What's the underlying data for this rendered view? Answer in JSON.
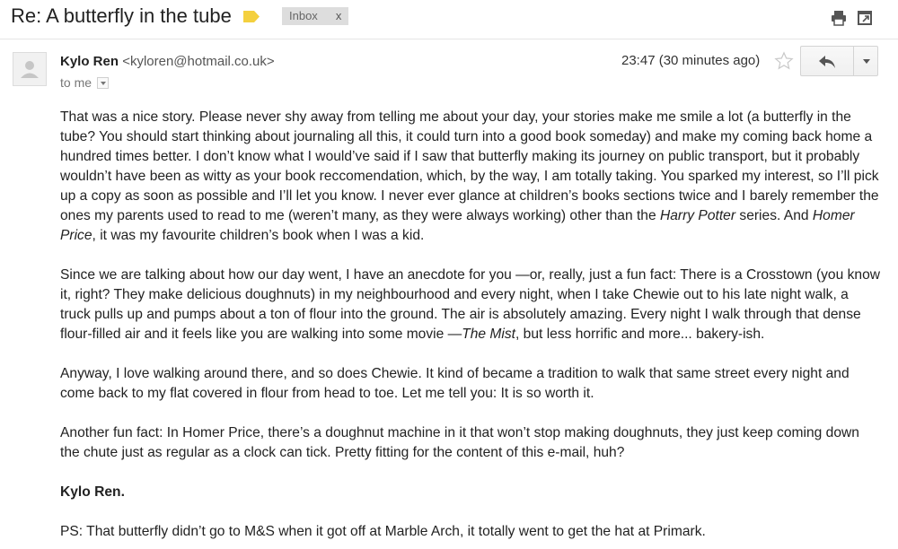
{
  "email": {
    "subject": "Re: A butterfly in the tube",
    "label": "Inbox",
    "label_remove": "x",
    "sender_name": "Kylo Ren",
    "sender_email": "<kyloren@hotmail.co.uk>",
    "recipient": "to me",
    "time": "23:47 (30 minutes ago)"
  },
  "icons": {
    "important": "important-marker-icon",
    "print": "print-icon",
    "popout": "new-window-icon",
    "star": "star-icon",
    "reply": "reply-icon",
    "more": "chevron-down-icon",
    "avatar": "person-icon"
  },
  "colors": {
    "important_marker": "#f4d03f",
    "label_chip": "#dddddd"
  },
  "body": {
    "p1_a": "That was a nice story. Please never shy away from telling me about your day, your stories make me smile a lot (a butterfly in the tube? You should start thinking about journaling all this, it could turn into a good book someday) and make my coming back home a hundred times better. I don’t know what I would’ve said if I saw that butterfly making its journey on public transport, but it probably wouldn’t have been as witty as your book reccomendation, which, by the way, I am totally taking. You sparked my interest, so I’ll pick up a copy as soon as possible and I’ll let you know. I never ever glance at children’s books sections twice and I barely remember the ones my parents used to read to me (weren’t many, as they were always working) other than the",
    "p1_title1": "Harry Potter",
    "p1_b": "series. And",
    "p1_title2": "Homer Price",
    "p1_c": ", it was my favourite children’s book when I was a kid.",
    "p2_a": "Since we are talking about how our day went, I have an anecdote for you —or, really, just a fun fact: There is a Crosstown (you know it, right? They make delicious doughnuts) in my neighbourhood and every night, when I take Chewie out to his late night walk, a truck pulls up and pumps about a ton of flour into the ground. The air is absolutely amazing. Every night I walk through that dense flour-filled air and it feels like you are walking into some movie —",
    "p2_title": "The Mist",
    "p2_b": ", but less horrific and more... bakery-ish.",
    "p3": "Anyway, I love walking around there, and so does Chewie. It kind of became a tradition to walk that same street every night and come back to my flat covered in flour from head to toe. Let me tell you: It is so worth it.",
    "p4": "Another fun fact: In Homer Price, there’s a doughnut machine in it that won’t stop making doughnuts, they just keep coming down the chute just as regular as a clock can tick. Pretty fitting for the content of this e-mail, huh?",
    "signature": "Kylo Ren.",
    "ps": "PS: That butterfly didn’t go to M&S when it got off at Marble Arch, it totally went to get the hat at Primark."
  }
}
